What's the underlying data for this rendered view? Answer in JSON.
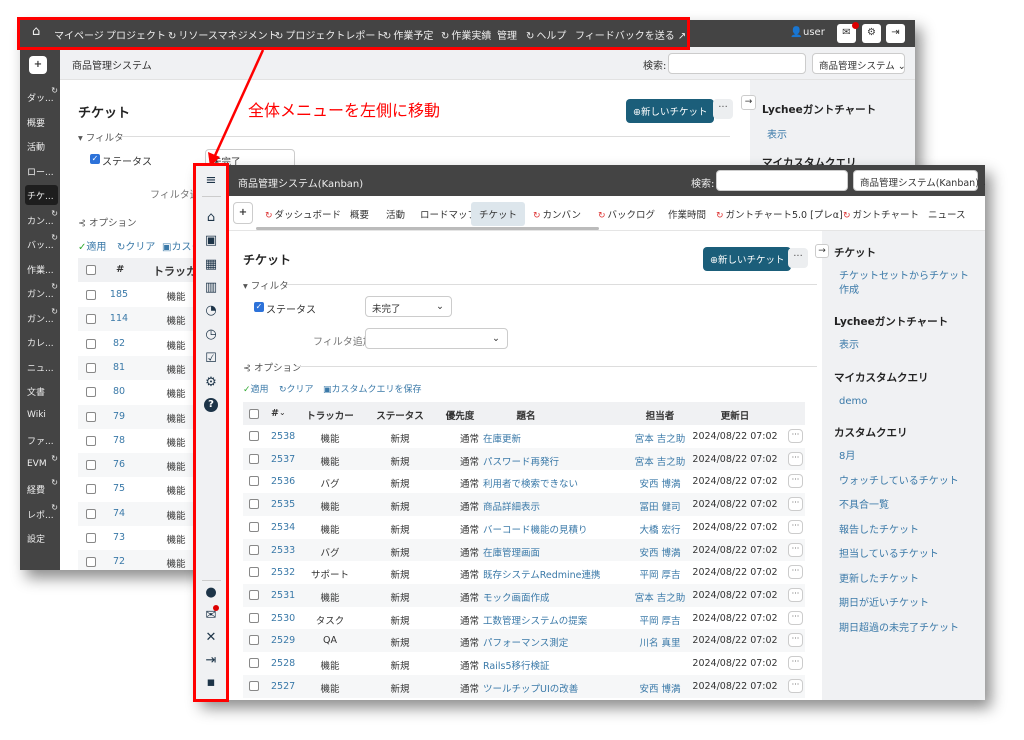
{
  "annotation": {
    "text": "全体メニューを左側に移動",
    "color": "#ff0000"
  },
  "back": {
    "topnav": [
      {
        "label": "マイページ"
      },
      {
        "label": "プロジェクト"
      },
      {
        "label": "リソースマネジメント",
        "r": 1
      },
      {
        "label": "プロジェクトレポート",
        "r": 1
      },
      {
        "label": "作業予定",
        "r": 1
      },
      {
        "label": "作業実績",
        "r": 1
      },
      {
        "label": "管理"
      },
      {
        "label": "ヘルプ",
        "r": 1
      },
      {
        "label": "フィードバックを送る"
      }
    ],
    "user": "user",
    "project_title": "商品管理システム",
    "search_label": "検索:",
    "project_select": "商品管理システム",
    "sidebar": [
      {
        "label": "ダッ...",
        "r": 1
      },
      {
        "label": "概要"
      },
      {
        "label": "活動"
      },
      {
        "label": "ロー..."
      },
      {
        "label": "チケ...",
        "active": 1
      },
      {
        "label": "カン...",
        "r": 1
      },
      {
        "label": "バッ...",
        "r": 1
      },
      {
        "label": "作業..."
      },
      {
        "label": "ガン...",
        "r": 1
      },
      {
        "label": "ガン...",
        "r": 1
      },
      {
        "label": "カレ..."
      },
      {
        "label": "ニュ..."
      },
      {
        "label": "文書"
      },
      {
        "label": "Wiki"
      },
      {
        "label": "ファ..."
      },
      {
        "label": "EVM",
        "r": 1
      },
      {
        "label": "経費",
        "r": 1
      },
      {
        "label": "レポ...",
        "r": 1
      },
      {
        "label": "設定"
      }
    ],
    "page_title": "チケット",
    "filter_legend": "フィルタ",
    "status_label": "ステータス",
    "status_value": "未完了",
    "add_filter": "フィルタ追加",
    "options_legend": "オプション",
    "apply": "適用",
    "clear": "クリア",
    "save_query": "カスタ",
    "col_id": "#",
    "col_tracker": "トラッカ",
    "rows": [
      [
        "185",
        "機能"
      ],
      [
        "114",
        "機能"
      ],
      [
        "82",
        "機能"
      ],
      [
        "81",
        "機能"
      ],
      [
        "80",
        "機能"
      ],
      [
        "79",
        "機能"
      ],
      [
        "78",
        "機能"
      ],
      [
        "76",
        "機能"
      ],
      [
        "75",
        "機能"
      ],
      [
        "74",
        "機能"
      ],
      [
        "73",
        "機能"
      ],
      [
        "72",
        "機能"
      ]
    ],
    "new_ticket": "新しいチケット",
    "right": {
      "h1": "Lycheeガントチャート",
      "l1": "表示",
      "h2": "マイカスタムクエリ"
    }
  },
  "front": {
    "project_title": "商品管理システム(Kanban)",
    "search_label": "検索:",
    "project_select": "商品管理システム(Kanban)",
    "tabs": [
      {
        "label": "ダッシュボード",
        "r": 1
      },
      {
        "label": "概要"
      },
      {
        "label": "活動"
      },
      {
        "label": "ロードマップ"
      },
      {
        "label": "チケット",
        "active": 1
      },
      {
        "label": "カンバン",
        "r": 1
      },
      {
        "label": "バックログ",
        "r": 1
      },
      {
        "label": "作業時間"
      },
      {
        "label": "ガントチャート5.0 [プレα]",
        "r": 1
      },
      {
        "label": "ガントチャート",
        "r": 1
      },
      {
        "label": "ニュース"
      }
    ],
    "page_title": "チケット",
    "new_ticket": "新しいチケット",
    "filter_legend": "フィルタ",
    "status_label": "ステータス",
    "status_value": "未完了",
    "add_filter": "フィルタ追加",
    "options_legend": "オプション",
    "apply": "適用",
    "clear": "クリア",
    "save_query": "カスタムクエリを保存",
    "columns": [
      "#",
      "トラッカー",
      "ステータス",
      "優先度",
      "題名",
      "担当者",
      "更新日"
    ],
    "rows": [
      [
        "2538",
        "機能",
        "新規",
        "通常",
        "在庫更新",
        "宮本 吉之助",
        "2024/08/22 07:02"
      ],
      [
        "2537",
        "機能",
        "新規",
        "通常",
        "パスワード再発行",
        "宮本 吉之助",
        "2024/08/22 07:02"
      ],
      [
        "2536",
        "バグ",
        "新規",
        "通常",
        "利用者で検索できない",
        "安西 博満",
        "2024/08/22 07:02"
      ],
      [
        "2535",
        "機能",
        "新規",
        "通常",
        "商品詳細表示",
        "冨田 健司",
        "2024/08/22 07:02"
      ],
      [
        "2534",
        "機能",
        "新規",
        "通常",
        "バーコード機能の見積り",
        "大橋 宏行",
        "2024/08/22 07:02"
      ],
      [
        "2533",
        "バグ",
        "新規",
        "通常",
        "在庫管理画面",
        "安西 博満",
        "2024/08/22 07:02"
      ],
      [
        "2532",
        "サポート",
        "新規",
        "通常",
        "既存システムRedmine連携",
        "平岡 厚吉",
        "2024/08/22 07:02"
      ],
      [
        "2531",
        "機能",
        "新規",
        "通常",
        "モック画面作成",
        "宮本 吉之助",
        "2024/08/22 07:02"
      ],
      [
        "2530",
        "タスク",
        "新規",
        "通常",
        "工数管理システムの提案",
        "平岡 厚吉",
        "2024/08/22 07:02"
      ],
      [
        "2529",
        "QA",
        "新規",
        "通常",
        "パフォーマンス測定",
        "川名 真里",
        "2024/08/22 07:02"
      ],
      [
        "2528",
        "機能",
        "新規",
        "通常",
        "Rails5移行検証",
        "",
        "2024/08/22 07:02"
      ],
      [
        "2527",
        "機能",
        "新規",
        "通常",
        "ツールチップUIの改善",
        "安西 博満",
        "2024/08/22 07:02"
      ]
    ],
    "right": {
      "sections": [
        {
          "title": "チケット",
          "links": [
            "チケットセットからチケット作成"
          ]
        },
        {
          "title": "Lycheeガントチャート",
          "links": [
            "表示"
          ]
        },
        {
          "title": "マイカスタムクエリ",
          "links": [
            "demo"
          ]
        },
        {
          "title": "カスタムクエリ",
          "links": [
            "8月",
            "ウォッチしているチケット",
            "不具合一覧",
            "報告したチケット",
            "担当しているチケット",
            "更新したチケット",
            "期日が近いチケット",
            "期日超過の未完了チケット"
          ]
        }
      ]
    },
    "icon_sidebar": [
      "menu-icon",
      "home-icon",
      "projects-icon",
      "dashboard-icon",
      "bar-chart-icon",
      "pie-chart-icon",
      "calendar-clock-icon",
      "calendar-check-icon",
      "user-gear-icon",
      "help-icon"
    ],
    "icon_sidebar_bottom": [
      "user-icon",
      "mail-icon",
      "tools-icon",
      "logout-icon",
      "feedback-icon"
    ]
  }
}
